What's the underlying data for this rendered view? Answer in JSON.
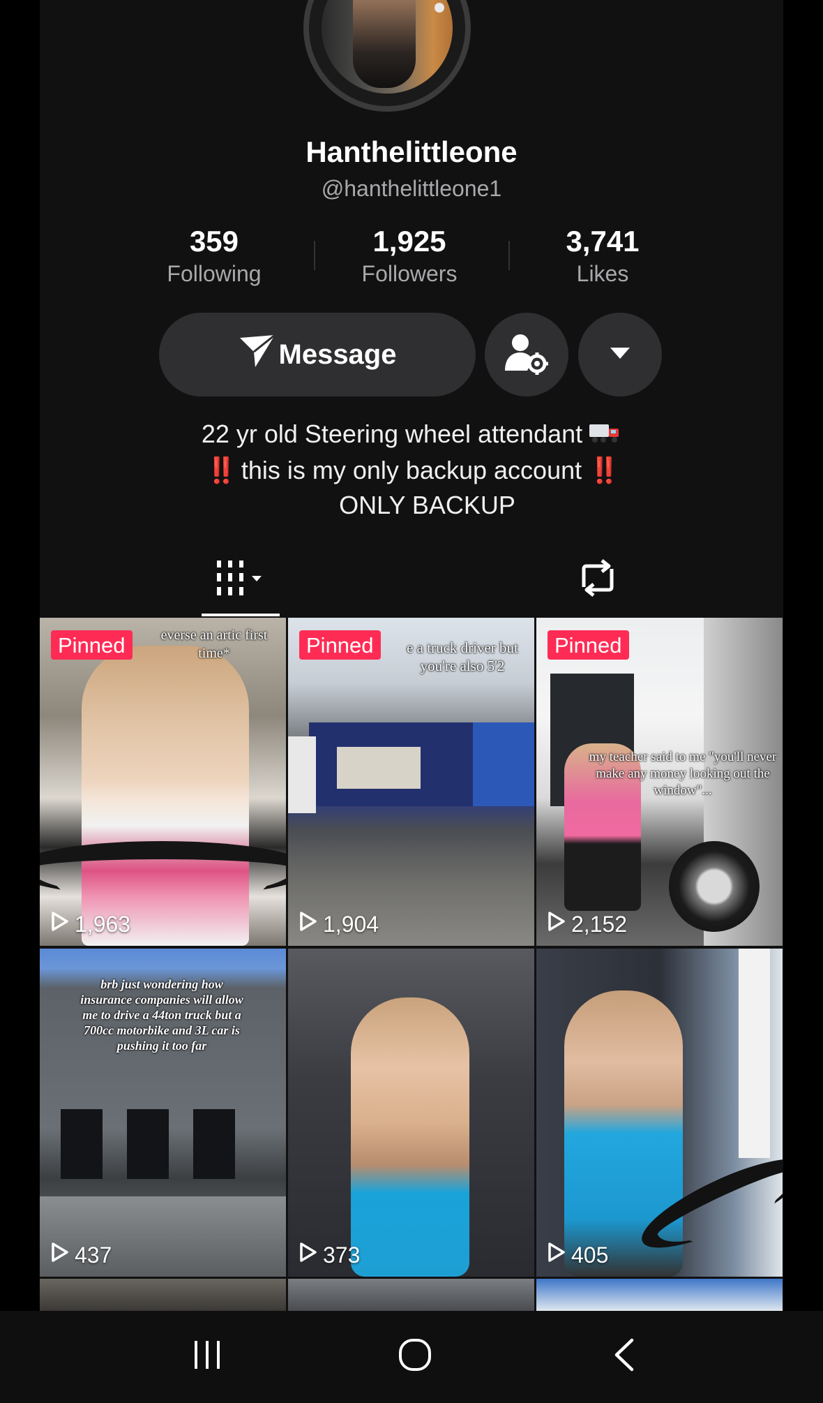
{
  "profile": {
    "display_name": "Hanthelittleone",
    "handle": "@hanthelittleone1"
  },
  "stats": [
    {
      "value": "359",
      "label": "Following"
    },
    {
      "value": "1,925",
      "label": "Followers"
    },
    {
      "value": "3,741",
      "label": "Likes"
    }
  ],
  "actions": {
    "message_label": "Message"
  },
  "bio": {
    "line1": "22 yr old Steering wheel attendant",
    "line2_marks": "‼️",
    "line2": "this is my only backup account",
    "line3": "ONLY BACKUP"
  },
  "videos": [
    {
      "pinned_label": "Pinned",
      "views": "1,963",
      "caption": "everse an artic first time*"
    },
    {
      "pinned_label": "Pinned",
      "views": "1,904",
      "caption": "e a truck driver but you're also 5'2"
    },
    {
      "pinned_label": "Pinned",
      "views": "2,152",
      "caption": "my teacher said to me \"you'll never make any money looking out the window\"..."
    },
    {
      "views": "437",
      "caption": "brb just wondering how insurance companies will allow me to drive a 44ton truck but a 700cc motorbike and 3L car is pushing it too far"
    },
    {
      "views": "373"
    },
    {
      "views": "405"
    }
  ],
  "colors": {
    "accent_pinned": "#fe2c55",
    "background": "#111112",
    "button_bg": "#2f2f31"
  },
  "icons": [
    "send-icon",
    "user-settings-icon",
    "caret-down-icon",
    "grid-menu-icon",
    "repost-icon",
    "play-icon",
    "recent-apps-icon",
    "home-icon",
    "back-icon"
  ]
}
